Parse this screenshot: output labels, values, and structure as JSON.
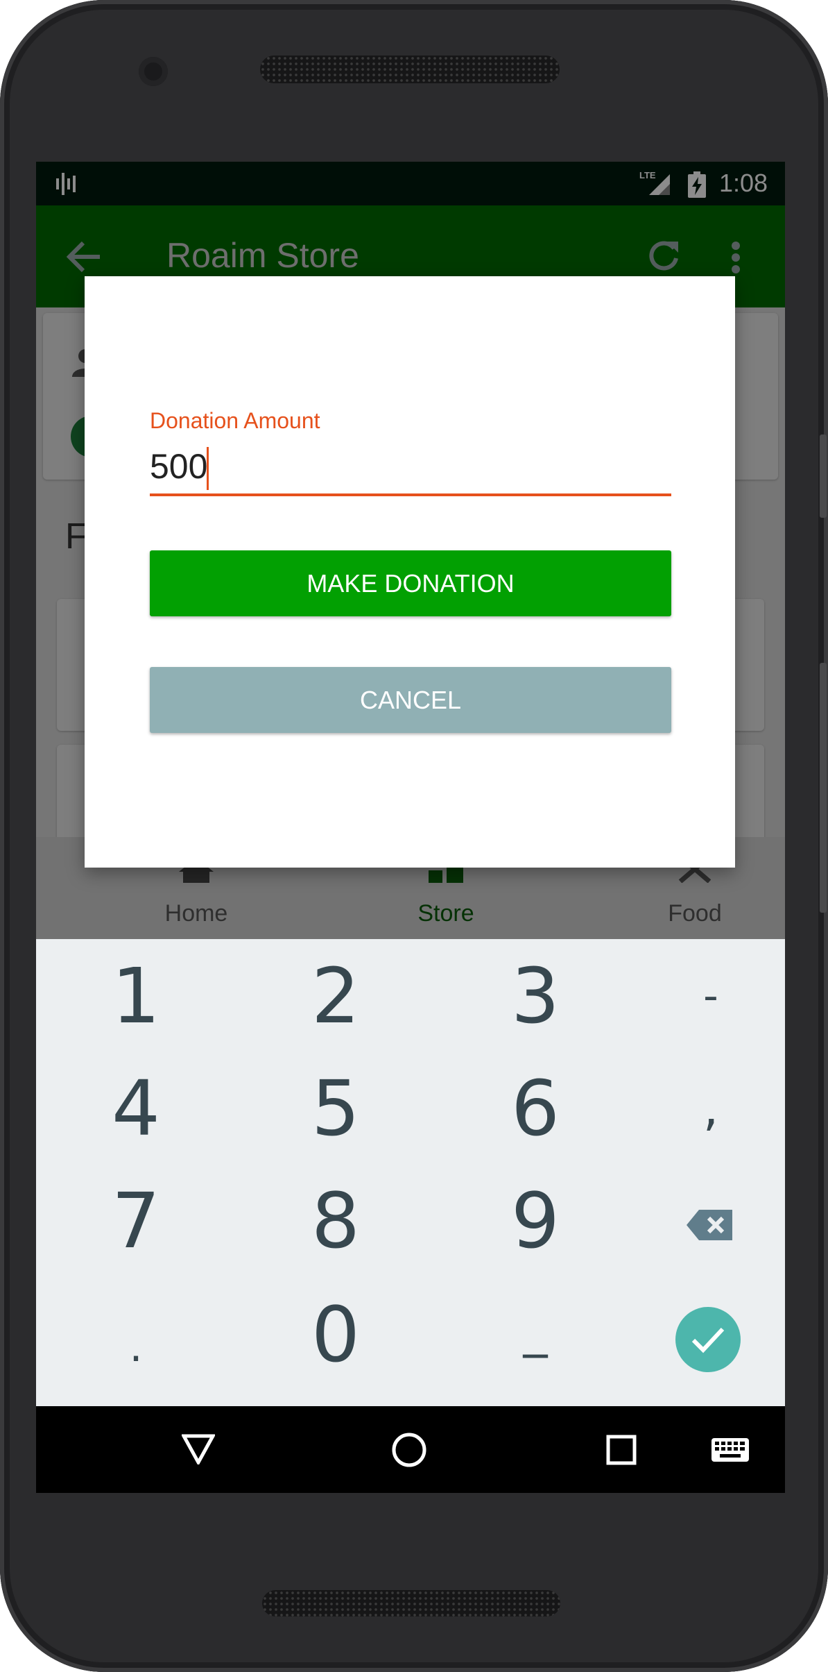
{
  "status_bar": {
    "time": "1:08",
    "network": "LTE"
  },
  "app_bar": {
    "title": "Roaim Store"
  },
  "bottom_nav": {
    "items": [
      {
        "label": "Home",
        "icon": "home-icon"
      },
      {
        "label": "Store",
        "icon": "store-icon"
      },
      {
        "label": "Food",
        "icon": "food-icon"
      }
    ],
    "active": "Store"
  },
  "background": {
    "section_initial": "F"
  },
  "dialog": {
    "field_label": "Donation Amount",
    "field_value": "500",
    "primary_button": "MAKE DONATION",
    "secondary_button": "CANCEL"
  },
  "keyboard": {
    "keys": [
      "1",
      "2",
      "3",
      "-",
      "4",
      "5",
      "6",
      ",",
      "7",
      "8",
      "9",
      "backspace",
      ".",
      "0",
      "_",
      "done"
    ]
  },
  "colors": {
    "app_bar": "#016a01",
    "accent": "#e6511c",
    "primary_button": "#02a002",
    "cancel_button": "#90b0b4",
    "done_key": "#4db6ac"
  }
}
